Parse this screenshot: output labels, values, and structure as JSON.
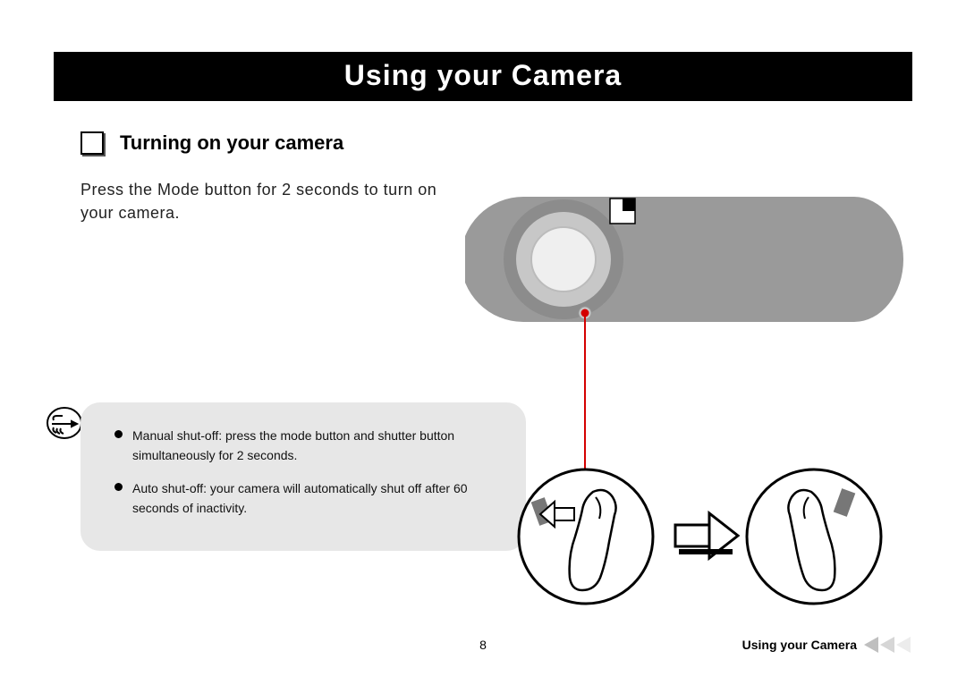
{
  "title": "Using  your Camera",
  "section": {
    "heading": "Turning on your camera",
    "body": "Press the Mode button for 2 seconds to turn on your camera."
  },
  "notes": [
    "Manual shut-off: press the mode button and shutter button simultaneously for 2 seconds.",
    "Auto shut-off: your camera will automatically shut off after 60 seconds of inactivity."
  ],
  "footer": {
    "page_number": "8",
    "label": "Using your Camera"
  }
}
